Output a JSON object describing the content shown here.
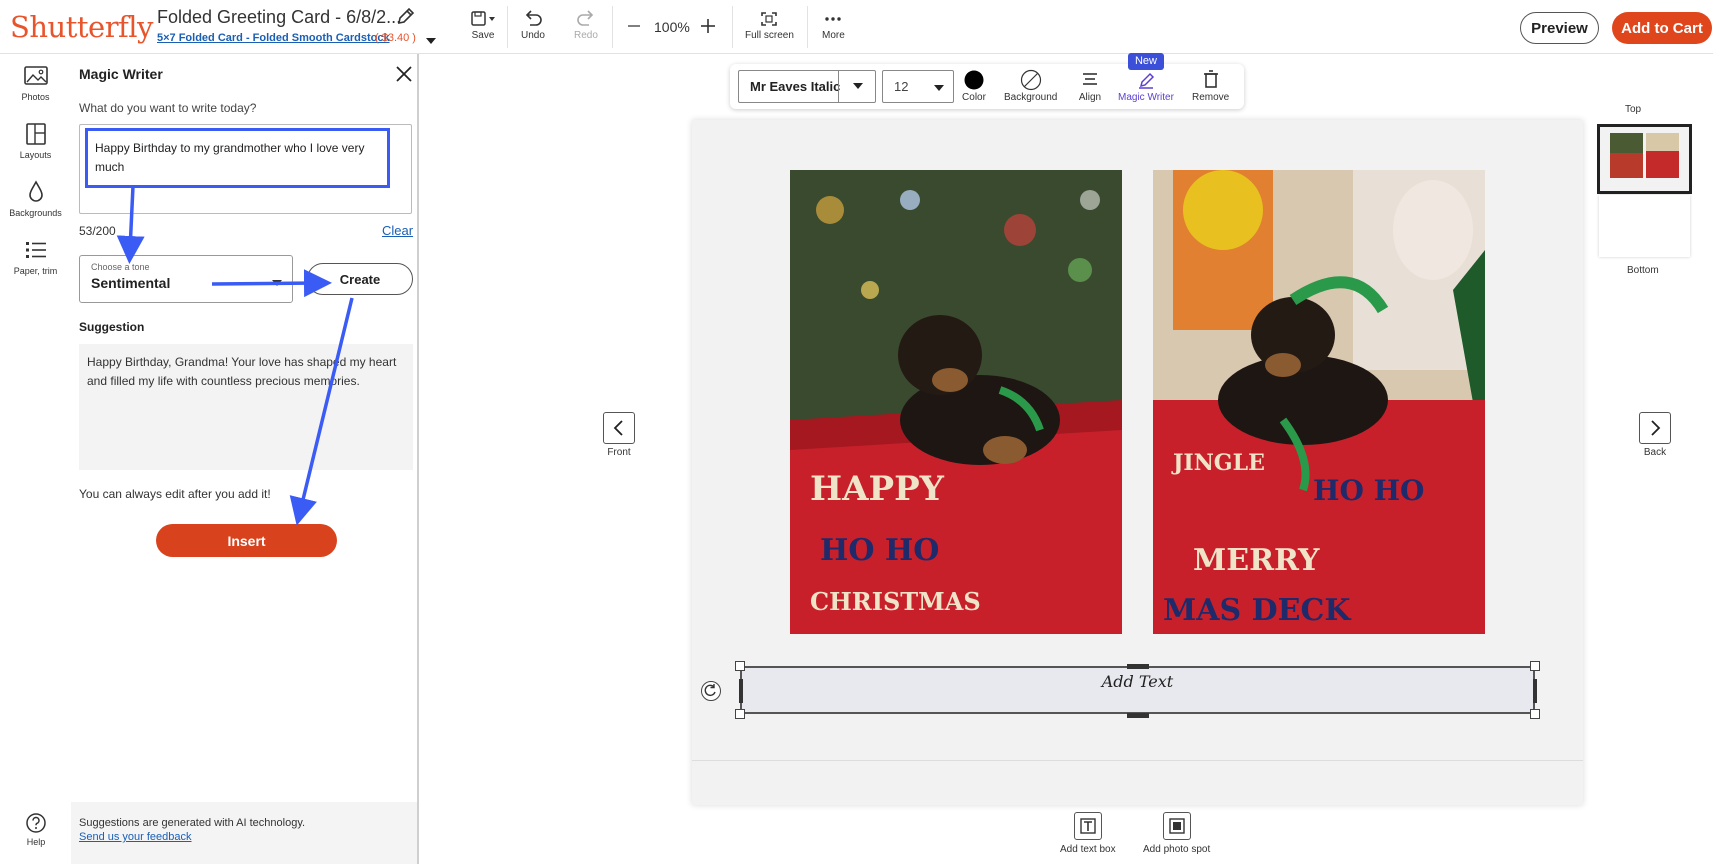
{
  "header": {
    "logo": "Shutterfly",
    "project_title": "Folded Greeting Card - 6/8/2...",
    "product": "5×7 Folded Card - Folded Smooth Cardstock",
    "price": "( $3.40 )",
    "save": "Save",
    "undo": "Undo",
    "redo": "Redo",
    "zoom": "100%",
    "fullscreen": "Full screen",
    "more": "More",
    "preview": "Preview",
    "add_to_cart": "Add to Cart"
  },
  "leftnav": {
    "items": [
      {
        "label": "Photos",
        "icon": "photos-icon"
      },
      {
        "label": "Layouts",
        "icon": "layouts-icon"
      },
      {
        "label": "Backgrounds",
        "icon": "backgrounds-icon"
      },
      {
        "label": "Paper, trim",
        "icon": "list-icon"
      }
    ],
    "help": "Help"
  },
  "panel": {
    "title": "Magic Writer",
    "question": "What do you want to write today?",
    "prompt": "Happy Birthday to my grandmother who I love very much",
    "counter": "53/200",
    "clear": "Clear",
    "tone_label": "Choose a tone",
    "tone_value": "Sentimental",
    "create": "Create",
    "suggestion_label": "Suggestion",
    "suggestion": "Happy Birthday, Grandma! Your love has shaped my heart and filled my life with countless precious memories.",
    "edit_note": "You can always edit after you add it!",
    "insert": "Insert",
    "ai_note": "Suggestions are generated with AI technology.",
    "feedback": "Send us your feedback"
  },
  "text_toolbar": {
    "font": "Mr Eaves Italic",
    "size": "12",
    "color": "Color",
    "background": "Background",
    "align": "Align",
    "magic_writer": "Magic Writer",
    "new_badge": "New",
    "remove": "Remove"
  },
  "canvas": {
    "text_placeholder": "Add Text",
    "front": "Front",
    "back": "Back",
    "thumb_top": "Top",
    "thumb_bottom": "Bottom",
    "add_text_box": "Add text box",
    "add_photo_spot": "Add photo spot"
  },
  "colors": {
    "brand": "#e8542b",
    "link": "#1a5fb4",
    "annotation": "#3b5bf5",
    "insert": "#d8431d"
  }
}
